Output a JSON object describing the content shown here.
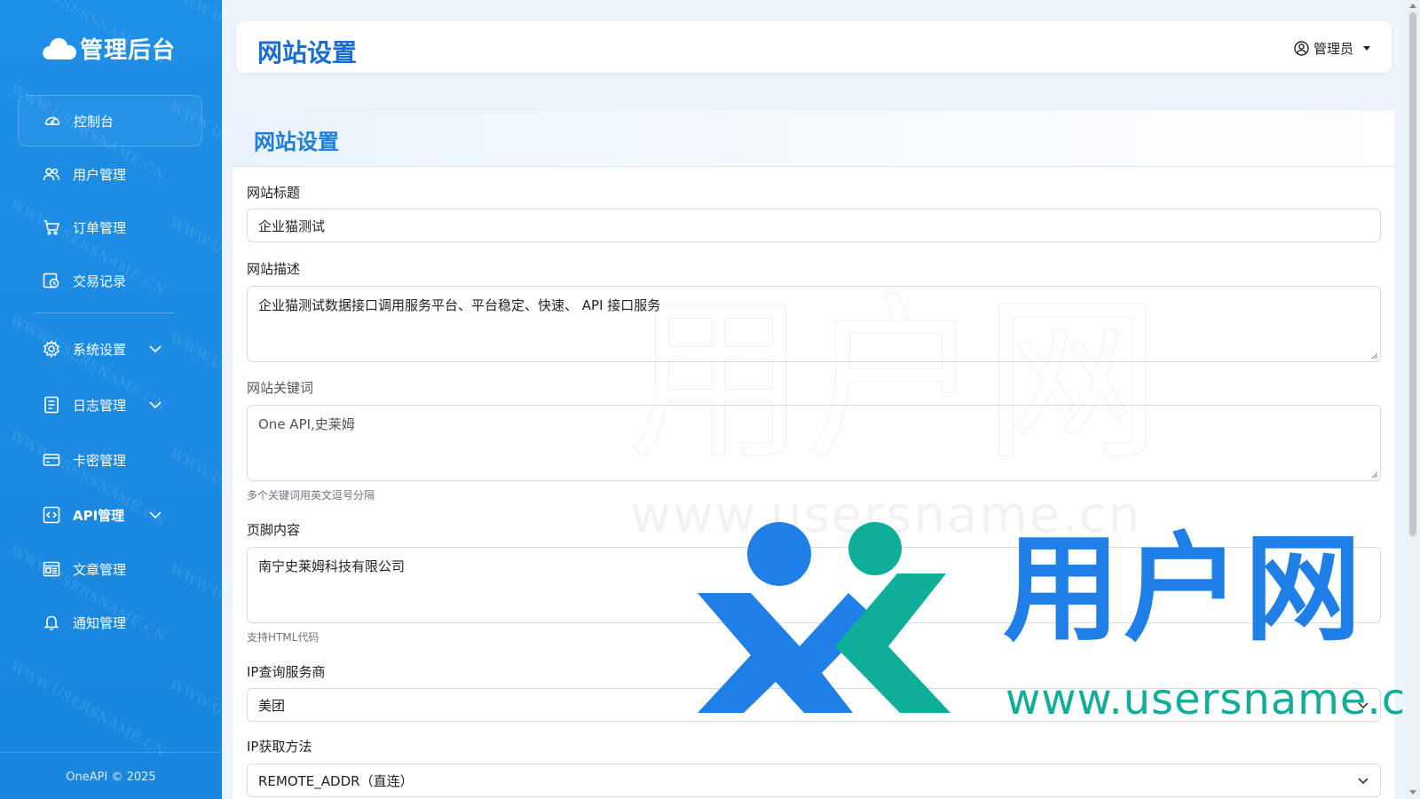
{
  "app": {
    "brand_title": "管理后台",
    "copyright": "OneAPI © 2025"
  },
  "sidebar": {
    "items": [
      {
        "label": "控制台",
        "icon": "dashboard-icon",
        "active": true
      },
      {
        "label": "用户管理",
        "icon": "users-icon"
      },
      {
        "label": "订单管理",
        "icon": "cart-icon"
      },
      {
        "label": "交易记录",
        "icon": "transaction-icon"
      },
      {
        "label": "系统设置",
        "icon": "gear-icon",
        "expandable": true
      },
      {
        "label": "日志管理",
        "icon": "log-icon",
        "expandable": true
      },
      {
        "label": "卡密管理",
        "icon": "card-icon"
      },
      {
        "label": "API管理",
        "icon": "code-icon",
        "expandable": true
      },
      {
        "label": "文章管理",
        "icon": "article-icon"
      },
      {
        "label": "通知管理",
        "icon": "bell-icon"
      }
    ]
  },
  "header": {
    "title": "网站设置",
    "user_label": "管理员"
  },
  "form": {
    "card_title": "网站设置",
    "site_title": {
      "label": "网站标题",
      "value": "企业猫测试"
    },
    "site_description": {
      "label": "网站描述",
      "value": "企业猫测试数据接口调用服务平台、平台稳定、快速、 API 接口服务"
    },
    "site_keywords": {
      "label": "网站关键词",
      "value": "One API,史莱姆",
      "help": "多个关键词用英文逗号分隔"
    },
    "footer_content": {
      "label": "页脚内容",
      "value": "南宁史莱姆科技有限公司",
      "help": "支持HTML代码"
    },
    "ip_provider": {
      "label": "IP查询服务商",
      "value": "美团"
    },
    "ip_method": {
      "label": "IP获取方法",
      "value": "REMOTE_ADDR（直连）"
    }
  },
  "watermark": {
    "sidebar_text": "WWW.USERSNAME.CN",
    "brand_cn": "用户网",
    "brand_url": "www.usersname.cn"
  },
  "colors": {
    "sidebar": "#1e8fe6",
    "accent": "#1b6ed1",
    "watermark_blue": "#1f7fe6",
    "watermark_green": "#0fae99"
  }
}
